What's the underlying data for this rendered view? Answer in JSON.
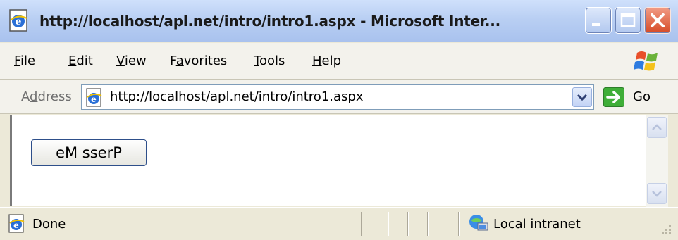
{
  "window": {
    "title": "http://localhost/apl.net/intro/intro1.aspx - Microsoft Inter..."
  },
  "menu": {
    "items": [
      {
        "access": "F",
        "rest": "ile"
      },
      {
        "access": "E",
        "rest": "dit"
      },
      {
        "access": "V",
        "rest": "iew"
      },
      {
        "pre": "F",
        "access": "a",
        "rest": "vorites"
      },
      {
        "access": "T",
        "rest": "ools"
      },
      {
        "access": "H",
        "rest": "elp"
      }
    ]
  },
  "address": {
    "label_pre": "A",
    "label_access": "d",
    "label_rest": "dress",
    "url": "http://localhost/apl.net/intro/intro1.aspx",
    "go_label": "Go"
  },
  "page": {
    "button_label": "eM sserP"
  },
  "status": {
    "text": "Done",
    "zone": "Local intranet"
  },
  "colors": {
    "go_green": "#3fae38",
    "close_red": "#d64a26",
    "title_blue": "#b9cff3"
  },
  "icons": {
    "title": "ie-page-icon",
    "logo": "windows-flag-icon",
    "address": "ie-page-icon",
    "go": "green-arrow-icon",
    "status": "ie-page-icon",
    "zone": "local-intranet-icon"
  }
}
